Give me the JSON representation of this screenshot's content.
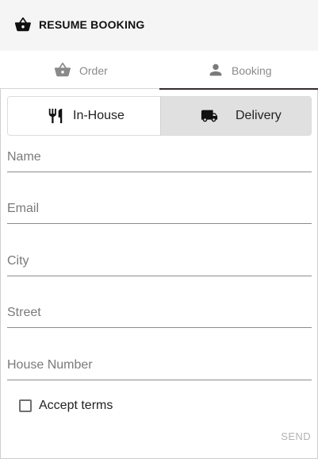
{
  "header": {
    "title": "RESUME BOOKING",
    "icon": "basket-icon"
  },
  "tabs": [
    {
      "label": "Order",
      "icon": "basket-icon",
      "active": false
    },
    {
      "label": "Booking",
      "icon": "person-icon",
      "active": true
    }
  ],
  "mode_toggle": {
    "selected": "Delivery",
    "options": [
      {
        "label": "In-House",
        "icon": "cutlery-icon"
      },
      {
        "label": "Delivery",
        "icon": "truck-icon"
      }
    ]
  },
  "form": {
    "fields": [
      {
        "placeholder": "Name",
        "value": ""
      },
      {
        "placeholder": "Email",
        "value": ""
      },
      {
        "placeholder": "City",
        "value": ""
      },
      {
        "placeholder": "Street",
        "value": ""
      },
      {
        "placeholder": "House Number",
        "value": ""
      }
    ],
    "accept_terms": {
      "label": "Accept terms",
      "checked": false
    },
    "send_label": "SEND"
  },
  "colors": {
    "header_bg": "#f5f5f5",
    "selected_toggle_bg": "#e0e0e0",
    "tab_indicator": "#3a2a2a",
    "disabled_text": "#b3b3b3"
  }
}
